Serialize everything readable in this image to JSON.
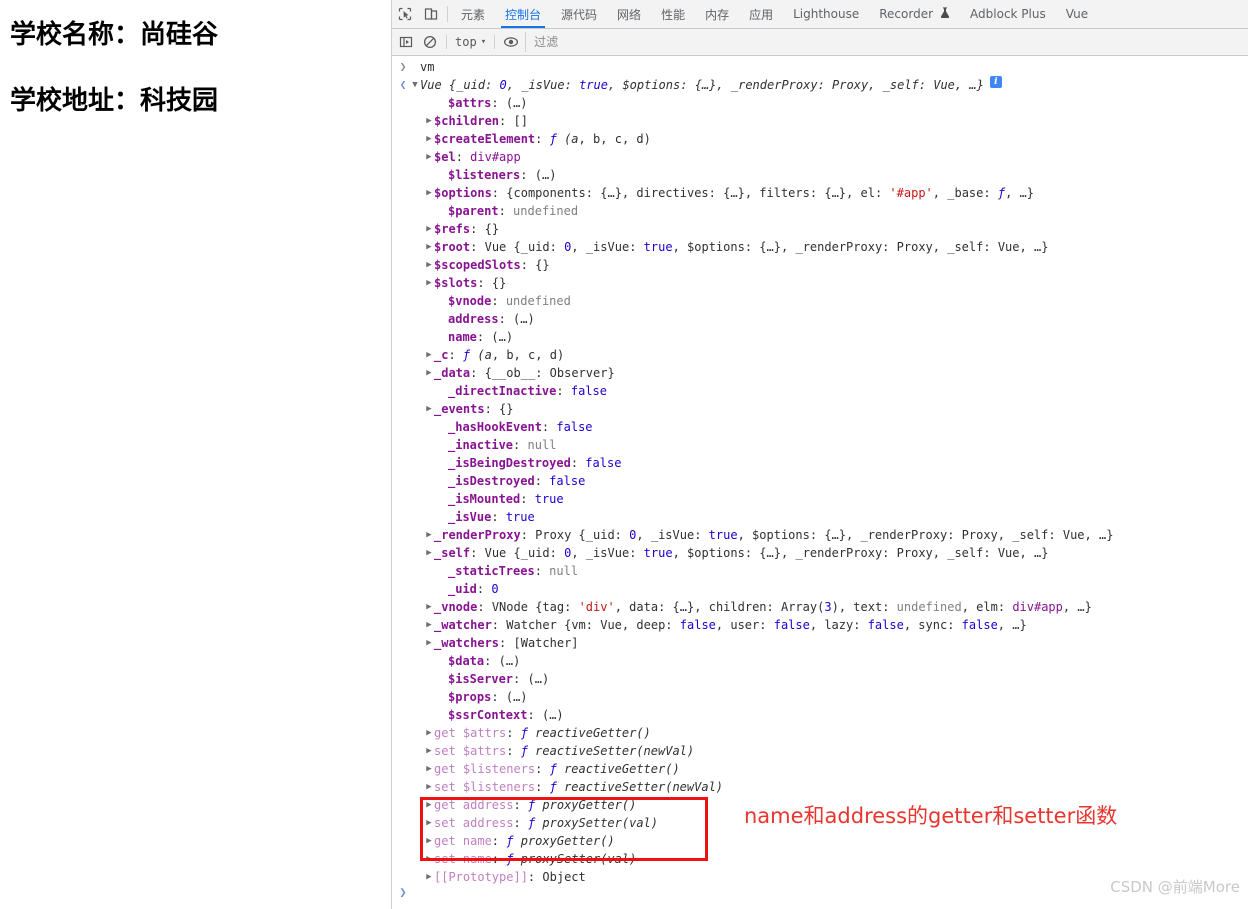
{
  "page": {
    "lines": [
      "学校名称：尚硅谷",
      "学校地址：科技园"
    ]
  },
  "devtools": {
    "tabs": [
      {
        "label": "元素",
        "active": false
      },
      {
        "label": "控制台",
        "active": true
      },
      {
        "label": "源代码",
        "active": false
      },
      {
        "label": "网络",
        "active": false
      },
      {
        "label": "性能",
        "active": false
      },
      {
        "label": "内存",
        "active": false
      },
      {
        "label": "应用",
        "active": false
      },
      {
        "label": "Lighthouse",
        "active": false
      },
      {
        "label": "Recorder",
        "active": false,
        "icon": "flask-icon"
      },
      {
        "label": "Adblock Plus",
        "active": false
      },
      {
        "label": "Vue",
        "active": false
      }
    ],
    "toolbar": {
      "inspect_icon": "inspect-element-icon",
      "device_icon": "device-toolbar-icon"
    },
    "filterbar": {
      "sidebar_icon": "console-sidebar-icon",
      "clear_icon": "clear-console-icon",
      "context_label": "top",
      "context_caret": "▾",
      "eye_icon": "live-expression-icon",
      "filter_placeholder": "过滤",
      "filter_value": ""
    }
  },
  "console": {
    "input_command": "vm",
    "info_badge": "i",
    "prompt_value": "",
    "rows": [
      {
        "type": "input",
        "indent": 0,
        "arrow": "none",
        "text": "vm"
      },
      {
        "type": "output",
        "indent": 0,
        "arrow": "down",
        "text": "Vue {_uid: 0, _isVue: true, $options: {…}, _renderProxy: Proxy, _self: Vue, …}",
        "badge": true
      },
      {
        "type": "prop",
        "indent": 2,
        "arrow": "none",
        "text": "$attrs: (…)"
      },
      {
        "type": "prop",
        "indent": 1,
        "arrow": "right",
        "text": "$children: []"
      },
      {
        "type": "prop",
        "indent": 1,
        "arrow": "right",
        "text": "$createElement: ƒ (a, b, c, d)"
      },
      {
        "type": "prop",
        "indent": 1,
        "arrow": "right",
        "text": "$el: div#app"
      },
      {
        "type": "prop",
        "indent": 2,
        "arrow": "none",
        "text": "$listeners: (…)"
      },
      {
        "type": "prop",
        "indent": 1,
        "arrow": "right",
        "text": "$options: {components: {…}, directives: {…}, filters: {…}, el: '#app', _base: ƒ, …}"
      },
      {
        "type": "prop",
        "indent": 2,
        "arrow": "none",
        "text": "$parent: undefined"
      },
      {
        "type": "prop",
        "indent": 1,
        "arrow": "right",
        "text": "$refs: {}"
      },
      {
        "type": "prop",
        "indent": 1,
        "arrow": "right",
        "text": "$root: Vue {_uid: 0, _isVue: true, $options: {…}, _renderProxy: Proxy, _self: Vue, …}"
      },
      {
        "type": "prop",
        "indent": 1,
        "arrow": "right",
        "text": "$scopedSlots: {}"
      },
      {
        "type": "prop",
        "indent": 1,
        "arrow": "right",
        "text": "$slots: {}"
      },
      {
        "type": "prop",
        "indent": 2,
        "arrow": "none",
        "text": "$vnode: undefined"
      },
      {
        "type": "prop",
        "indent": 2,
        "arrow": "none",
        "text": "address: (…)"
      },
      {
        "type": "prop",
        "indent": 2,
        "arrow": "none",
        "text": "name: (…)"
      },
      {
        "type": "prop",
        "indent": 1,
        "arrow": "right",
        "text": "_c: ƒ (a, b, c, d)"
      },
      {
        "type": "prop",
        "indent": 1,
        "arrow": "right",
        "text": "_data: {__ob__: Observer}"
      },
      {
        "type": "prop",
        "indent": 2,
        "arrow": "none",
        "text": "_directInactive: false"
      },
      {
        "type": "prop",
        "indent": 1,
        "arrow": "right",
        "text": "_events: {}"
      },
      {
        "type": "prop",
        "indent": 2,
        "arrow": "none",
        "text": "_hasHookEvent: false"
      },
      {
        "type": "prop",
        "indent": 2,
        "arrow": "none",
        "text": "_inactive: null"
      },
      {
        "type": "prop",
        "indent": 2,
        "arrow": "none",
        "text": "_isBeingDestroyed: false"
      },
      {
        "type": "prop",
        "indent": 2,
        "arrow": "none",
        "text": "_isDestroyed: false"
      },
      {
        "type": "prop",
        "indent": 2,
        "arrow": "none",
        "text": "_isMounted: true"
      },
      {
        "type": "prop",
        "indent": 2,
        "arrow": "none",
        "text": "_isVue: true"
      },
      {
        "type": "prop",
        "indent": 1,
        "arrow": "right",
        "text": "_renderProxy: Proxy {_uid: 0, _isVue: true, $options: {…}, _renderProxy: Proxy, _self: Vue, …}"
      },
      {
        "type": "prop",
        "indent": 1,
        "arrow": "right",
        "text": "_self: Vue {_uid: 0, _isVue: true, $options: {…}, _renderProxy: Proxy, _self: Vue, …}"
      },
      {
        "type": "prop",
        "indent": 2,
        "arrow": "none",
        "text": "_staticTrees: null"
      },
      {
        "type": "prop",
        "indent": 2,
        "arrow": "none",
        "text": "_uid: 0"
      },
      {
        "type": "prop",
        "indent": 1,
        "arrow": "right",
        "text": "_vnode: VNode {tag: 'div', data: {…}, children: Array(3), text: undefined, elm: div#app, …}"
      },
      {
        "type": "prop",
        "indent": 1,
        "arrow": "right",
        "text": "_watcher: Watcher {vm: Vue, deep: false, user: false, lazy: false, sync: false, …}"
      },
      {
        "type": "prop",
        "indent": 1,
        "arrow": "right",
        "text": "_watchers: [Watcher]"
      },
      {
        "type": "prop",
        "indent": 2,
        "arrow": "none",
        "text": "$data: (…)"
      },
      {
        "type": "prop",
        "indent": 2,
        "arrow": "none",
        "text": "$isServer: (…)"
      },
      {
        "type": "prop",
        "indent": 2,
        "arrow": "none",
        "text": "$props: (…)"
      },
      {
        "type": "prop",
        "indent": 2,
        "arrow": "none",
        "text": "$ssrContext: (…)"
      },
      {
        "type": "accessor",
        "indent": 1,
        "arrow": "right",
        "text": "get $attrs: ƒ reactiveGetter()"
      },
      {
        "type": "accessor",
        "indent": 1,
        "arrow": "right",
        "text": "set $attrs: ƒ reactiveSetter(newVal)"
      },
      {
        "type": "accessor",
        "indent": 1,
        "arrow": "right",
        "text": "get $listeners: ƒ reactiveGetter()"
      },
      {
        "type": "accessor",
        "indent": 1,
        "arrow": "right",
        "text": "set $listeners: ƒ reactiveSetter(newVal)"
      },
      {
        "type": "accessor",
        "indent": 1,
        "arrow": "right",
        "text": "get address: ƒ proxyGetter()"
      },
      {
        "type": "accessor",
        "indent": 1,
        "arrow": "right",
        "text": "set address: ƒ proxySetter(val)"
      },
      {
        "type": "accessor",
        "indent": 1,
        "arrow": "right",
        "text": "get name: ƒ proxyGetter()"
      },
      {
        "type": "accessor",
        "indent": 1,
        "arrow": "right",
        "text": "set name: ƒ proxySetter(val)"
      },
      {
        "type": "prop",
        "indent": 1,
        "arrow": "right",
        "text": "[[Prototype]]: Object"
      }
    ]
  },
  "annotation": {
    "text": "name和address的getter和setter函数",
    "color": "#e8352e"
  },
  "watermark": {
    "text": "CSDN @前端More"
  }
}
